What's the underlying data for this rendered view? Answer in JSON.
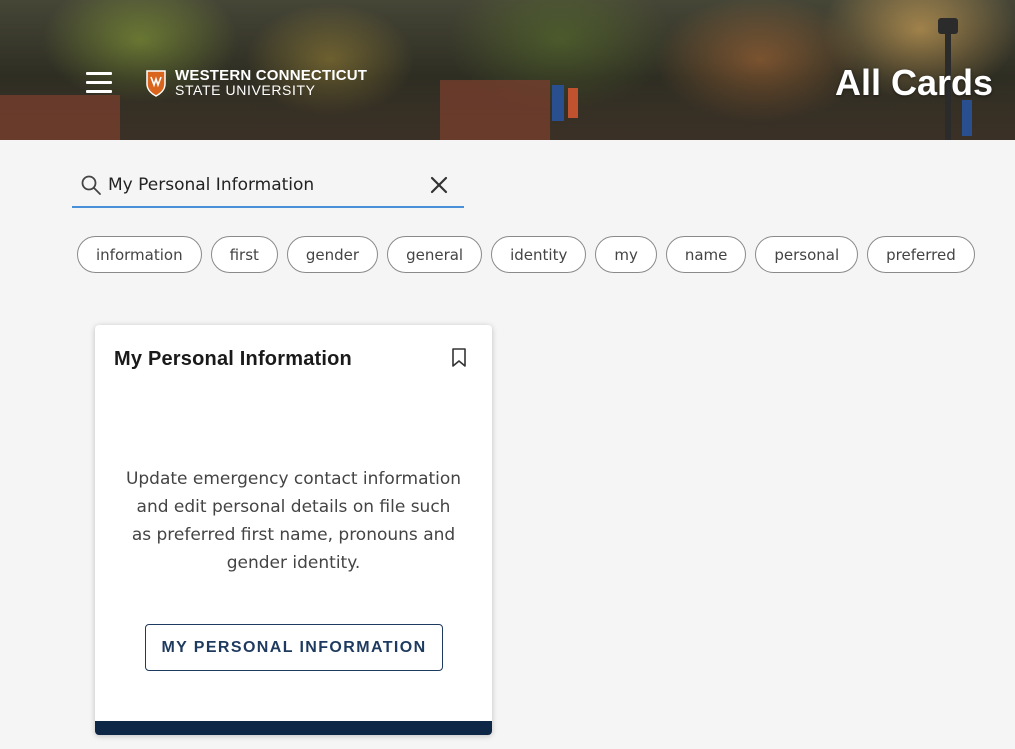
{
  "header": {
    "logo_line1": "WESTERN CONNECTICUT",
    "logo_line2": "STATE UNIVERSITY",
    "page_title": "All Cards"
  },
  "search": {
    "value": "My Personal Information",
    "icon": "search-icon",
    "clear_icon": "close-icon"
  },
  "chips": [
    "information",
    "first",
    "gender",
    "general",
    "identity",
    "my",
    "name",
    "personal",
    "preferred"
  ],
  "card": {
    "title": "My Personal Information",
    "bookmark_icon": "bookmark-icon",
    "description": "Update emergency contact information and edit personal details on file such as preferred first name, pronouns and gender identity.",
    "button_label": "MY PERSONAL INFORMATION"
  },
  "colors": {
    "accent_blue": "#4a90d9",
    "navy": "#0e2747",
    "button_text": "#1e3a5f"
  }
}
